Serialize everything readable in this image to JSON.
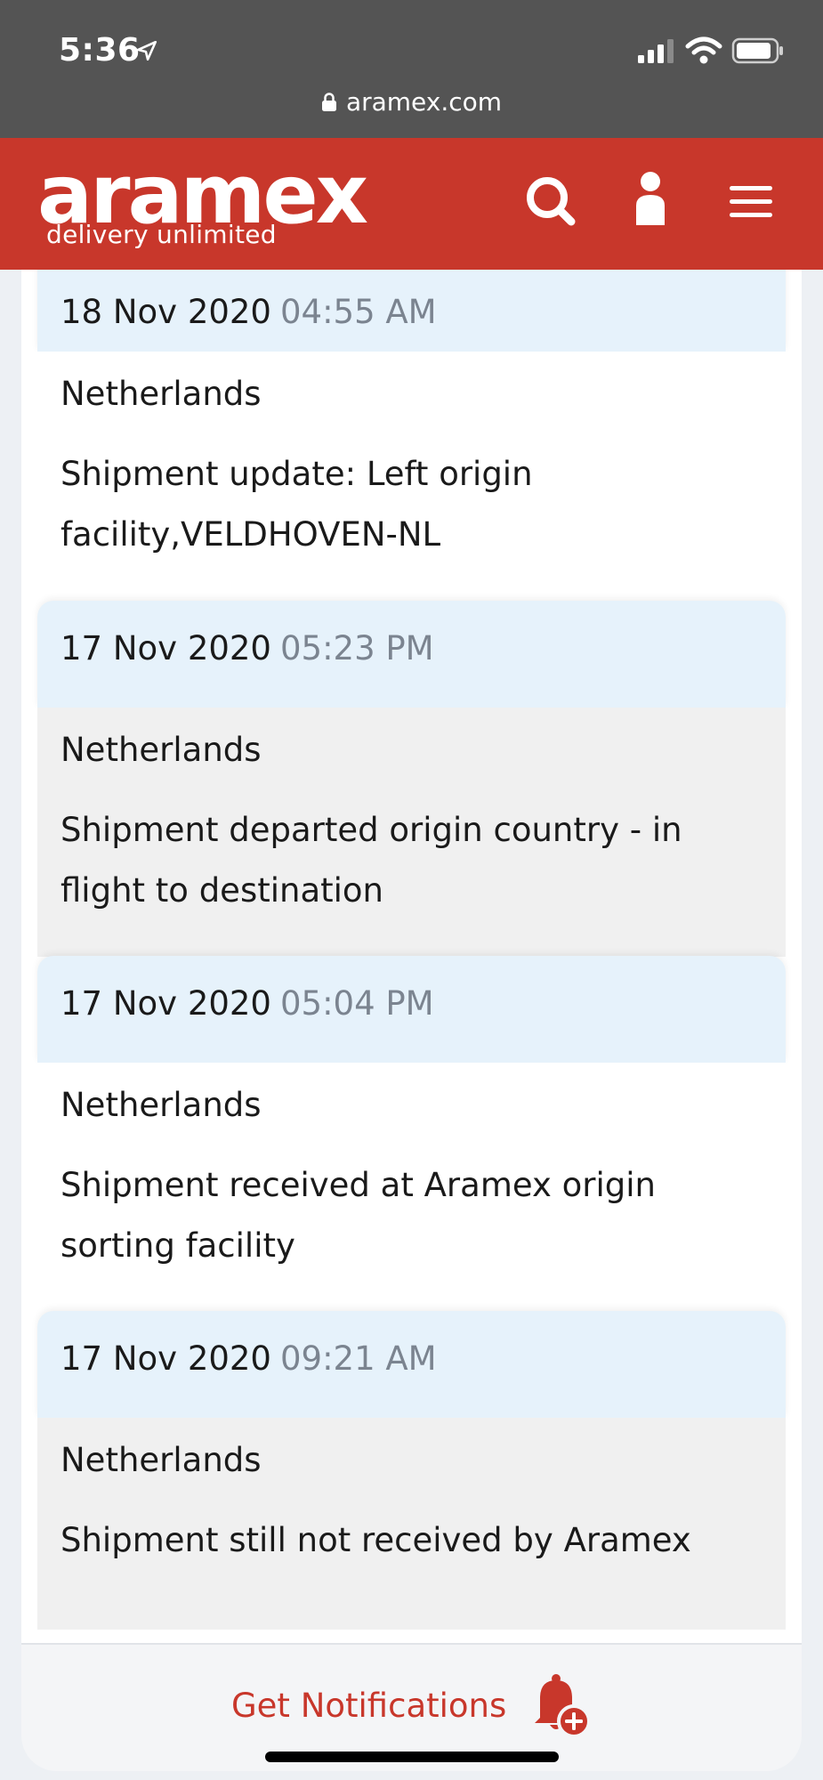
{
  "status_bar": {
    "time": "5:36",
    "url": "aramex.com"
  },
  "header": {
    "logo": "aramex",
    "tagline": "delivery unlimited",
    "icons": [
      "search-icon",
      "user-icon",
      "menu-icon"
    ]
  },
  "tracking": {
    "entries": [
      {
        "date": "18 Nov 2020",
        "time": "04:55 AM",
        "location": "Netherlands",
        "description": "Shipment update: Left origin facility,VELDHOVEN-NL"
      },
      {
        "date": "17 Nov 2020",
        "time": "05:23 PM",
        "location": "Netherlands",
        "description": "Shipment departed origin country - in flight to destination"
      },
      {
        "date": "17 Nov 2020",
        "time": "05:04 PM",
        "location": "Netherlands",
        "description": "Shipment received at Aramex origin sorting facility"
      },
      {
        "date": "17 Nov 2020",
        "time": "09:21 AM",
        "location": "Netherlands",
        "description": "Shipment still not received by Aramex"
      }
    ]
  },
  "notifications": {
    "label": "Get Notifications",
    "icon": "bell-plus-icon"
  },
  "colors": {
    "brand": "#c8372b",
    "date_bg": "#e6f2fb",
    "alt_row_bg": "#f0f0f0",
    "time_gray": "#7b8490"
  }
}
